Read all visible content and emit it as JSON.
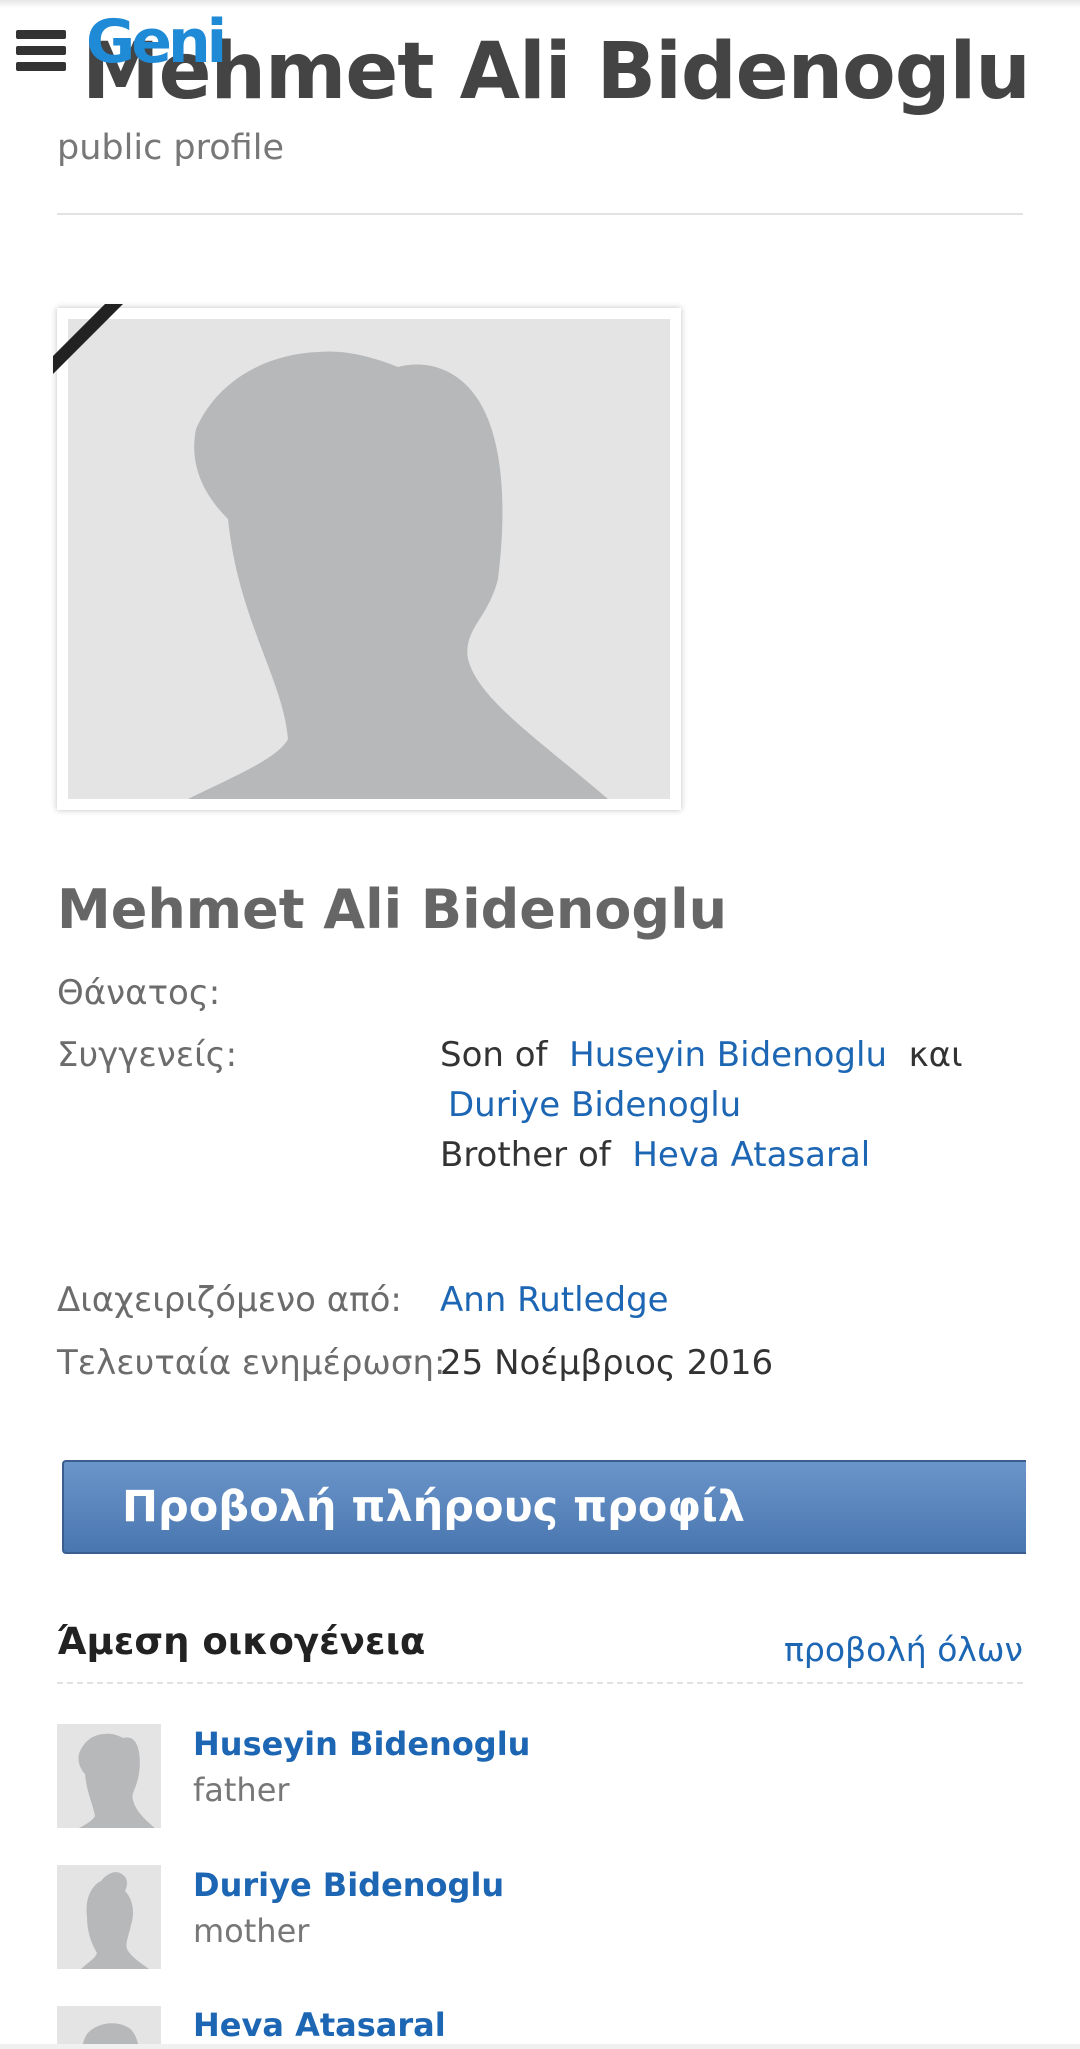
{
  "header": {
    "logo": "Geni",
    "title": "Mehmet Ali Bidenoglu",
    "subtitle": "public profile"
  },
  "profile": {
    "name": "Mehmet Ali Bidenoglu",
    "death_label": "Θάνατος:",
    "relatives_label": "Συγγενείς:",
    "son_of_prefix": "Son of",
    "father_name": "Huseyin Bidenoglu",
    "conjunction": "και",
    "mother_name": "Duriye Bidenoglu",
    "brother_of_prefix": "Brother of",
    "sibling_name": "Heva Atasaral",
    "managed_by_label": "Διαχειριζόμενο από:",
    "manager_name": "Ann Rutledge",
    "last_updated_label": "Τελευταία ενημέρωση:",
    "last_updated_value": "25 Νοέμβριος 2016"
  },
  "view_full_profile_label": "Προβολή πλήρους προφίλ",
  "family": {
    "title": "Άμεση οικογένεια",
    "view_all": "προβολή όλων",
    "members": [
      {
        "name": "Huseyin Bidenoglu",
        "relation": "father",
        "avatar": "male"
      },
      {
        "name": "Duriye Bidenoglu",
        "relation": "mother",
        "avatar": "female"
      },
      {
        "name": "Heva Atasaral",
        "relation": "",
        "avatar": "female"
      }
    ]
  },
  "colors": {
    "link": "#1d66b3",
    "logo": "#1f8ad6",
    "button": "#5a86bf"
  }
}
